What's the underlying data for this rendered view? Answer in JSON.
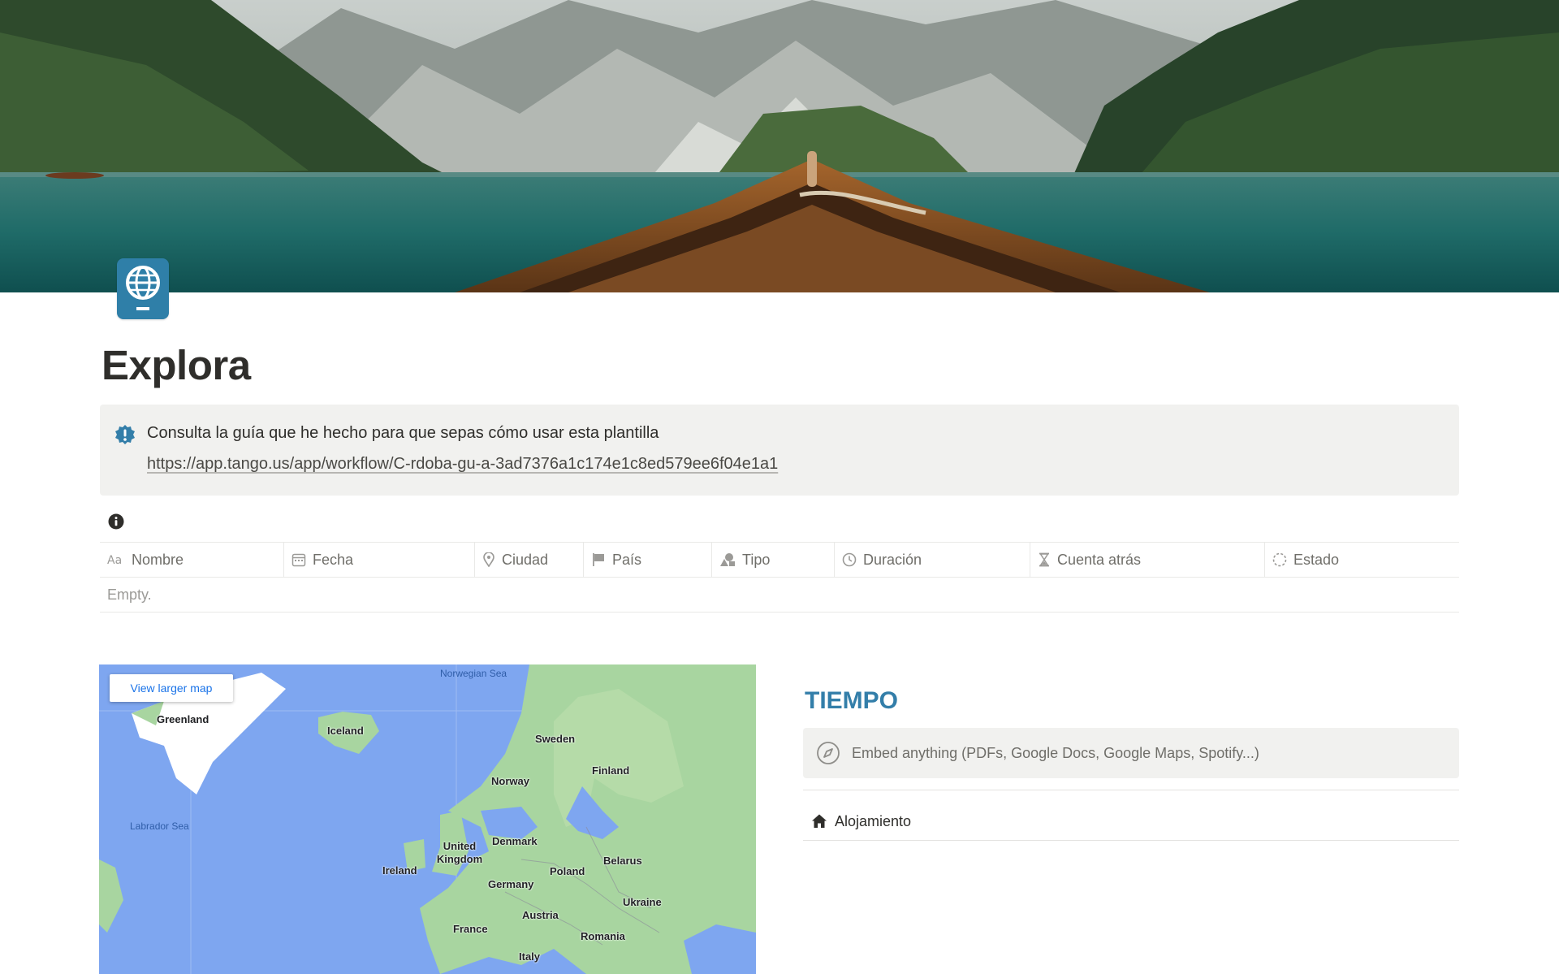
{
  "page": {
    "title": "Explora",
    "icon": "passport-globe-icon",
    "cover": "mountain-lake-boat-cover"
  },
  "callout": {
    "icon": "exclamation-badge-icon",
    "text": "Consulta la guía que he hecho para que sepas cómo usar esta plantilla",
    "link": "https://app.tango.us/app/workflow/C-rdoba-gu-a-3ad7376a1c174e1c8ed579ee6f04e1a1"
  },
  "database": {
    "columns": [
      {
        "label": "Nombre",
        "icon": "text-aa-icon"
      },
      {
        "label": "Fecha",
        "icon": "calendar-icon"
      },
      {
        "label": "Ciudad",
        "icon": "location-pin-icon"
      },
      {
        "label": "País",
        "icon": "flag-icon"
      },
      {
        "label": "Tipo",
        "icon": "shapes-icon"
      },
      {
        "label": "Duración",
        "icon": "clock-icon"
      },
      {
        "label": "Cuenta atrás",
        "icon": "hourglass-icon"
      },
      {
        "label": "Estado",
        "icon": "status-circle-icon"
      }
    ],
    "empty_text": "Empty."
  },
  "map": {
    "button": "View larger map",
    "seas": [
      "Norwegian Sea",
      "Labrador Sea"
    ],
    "places": [
      "Greenland",
      "Iceland",
      "Sweden",
      "Finland",
      "Norway",
      "United Kingdom",
      "Denmark",
      "Ireland",
      "Belarus",
      "Poland",
      "Germany",
      "Ukraine",
      "Austria",
      "France",
      "Romania",
      "Italy"
    ]
  },
  "right": {
    "heading": "TIEMPO",
    "embed_placeholder": "Embed anything (PDFs, Google Docs, Google Maps, Spotify...)",
    "link": "Alojamiento"
  },
  "colors": {
    "accent_blue": "#337ea9",
    "callout_bg": "#f1f1ef",
    "text": "#37352f",
    "muted": "#6f6e69"
  }
}
